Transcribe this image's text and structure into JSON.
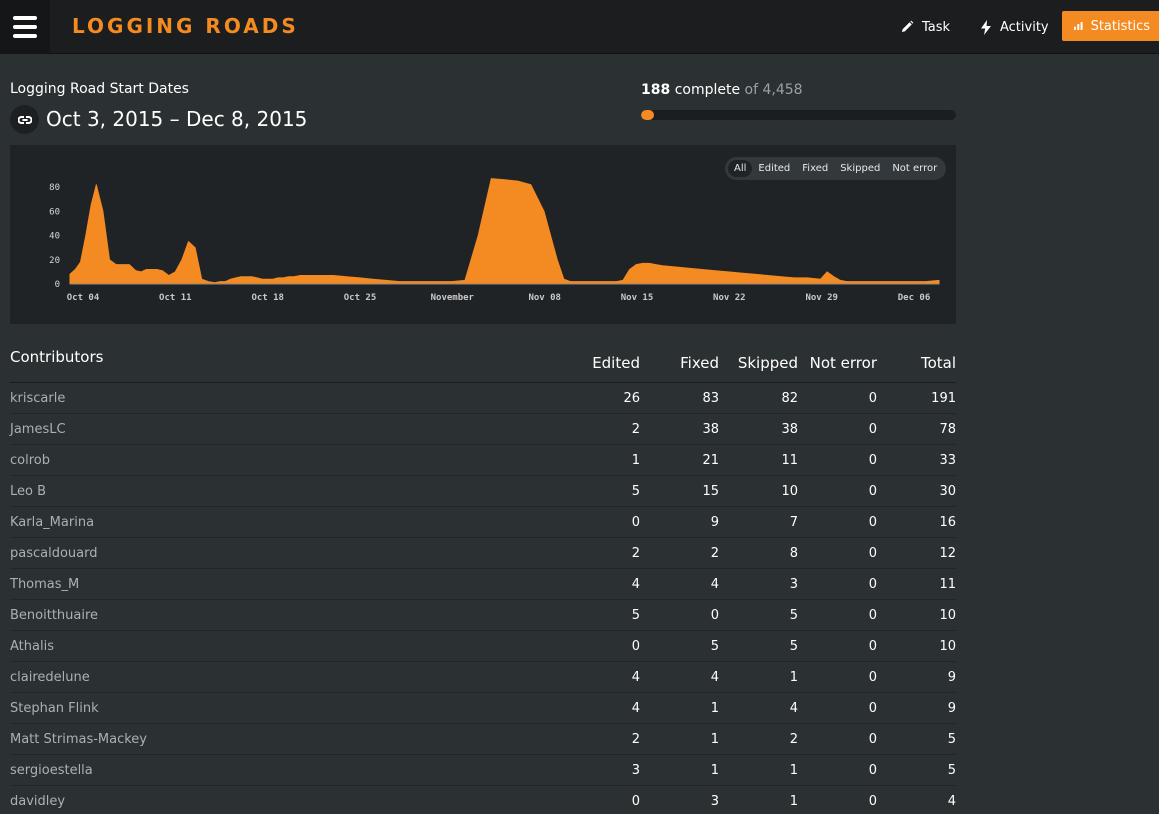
{
  "header": {
    "logo": "LOGGING ROADS",
    "nav": [
      {
        "label": "Task",
        "icon": "pencil-icon"
      },
      {
        "label": "Activity",
        "icon": "bolt-icon"
      },
      {
        "label": "Statistics",
        "icon": "bar-chart-icon",
        "active": true
      }
    ]
  },
  "title": {
    "label": "Logging Road Start Dates",
    "date_range": "Oct 3, 2015 – Dec 8, 2015",
    "icon": "link-icon"
  },
  "progress": {
    "complete": "188",
    "complete_label": "complete",
    "of_label": "of 4,458",
    "fraction": 0.042
  },
  "filters": [
    "All",
    "Edited",
    "Fixed",
    "Skipped",
    "Not error"
  ],
  "chart_data": {
    "type": "area",
    "color": "#f48a22",
    "x_tick_labels": [
      "Oct 04",
      "Oct 11",
      "Oct 18",
      "Oct 25",
      "November",
      "Nov 08",
      "Nov 15",
      "Nov 22",
      "Nov 29",
      "Dec 06"
    ],
    "y_tick_labels": [
      "0",
      "20",
      "40",
      "60",
      "80"
    ],
    "ylim": [
      0,
      90
    ],
    "x": [
      0,
      0.4,
      0.8,
      1.2,
      1.6,
      2.0,
      2.5,
      3.0,
      3.5,
      4.0,
      4.5,
      5.0,
      5.4,
      5.8,
      6.2,
      6.6,
      7.0,
      7.5,
      8.0,
      8.5,
      9.0,
      9.5,
      10.0,
      10.5,
      11.0,
      11.4,
      11.8,
      12.2,
      12.6,
      13.0,
      13.4,
      13.8,
      14.2,
      14.6,
      15.0,
      15.4,
      15.8,
      16.2,
      16.6,
      17.0,
      17.5,
      18.0,
      18.5,
      19.0,
      19.5,
      20.0,
      21.0,
      22.0,
      23.0,
      24.0,
      25.0,
      26.0,
      27.0,
      28.0,
      29.0,
      30.0,
      31.0,
      32.0,
      33.0,
      34.0,
      35.0,
      36.0,
      36.5,
      37.0,
      37.5,
      38.0,
      38.5,
      39.0,
      39.5,
      40.0,
      40.5,
      41.0,
      41.5,
      42.0,
      42.5,
      43.0,
      43.5,
      44.0,
      44.5,
      45.0,
      46.0,
      47.0,
      48.0,
      49.0,
      50.0,
      51.0,
      52.0,
      53.0,
      54.0,
      55.0,
      56.0,
      57.0,
      57.5,
      58.0,
      58.5,
      59.0,
      60.0,
      61.0,
      62.0,
      63.0,
      64.0,
      65.0,
      66.0
    ],
    "values": [
      8,
      12,
      18,
      40,
      65,
      82,
      60,
      20,
      16,
      16,
      16,
      11,
      10,
      12,
      12,
      12,
      11,
      7,
      10,
      20,
      35,
      30,
      4,
      2,
      1,
      2,
      2,
      4,
      5,
      6,
      6,
      6,
      5,
      4,
      4,
      4,
      5,
      5,
      6,
      6,
      7,
      7,
      7,
      7,
      7,
      7,
      6,
      5,
      4,
      3,
      2,
      2,
      2,
      2,
      2,
      3,
      40,
      87,
      86,
      85,
      82,
      60,
      40,
      20,
      4,
      2,
      2,
      2,
      2,
      2,
      2,
      2,
      2,
      3,
      12,
      16,
      17,
      17,
      16,
      15,
      14,
      13,
      12,
      11,
      10,
      9,
      8,
      7,
      6,
      5,
      5,
      4,
      10,
      6,
      3,
      2,
      2,
      2,
      2,
      2,
      2,
      2,
      3
    ]
  },
  "table": {
    "title": "Contributors",
    "columns": [
      "Edited",
      "Fixed",
      "Skipped",
      "Not error",
      "Total"
    ],
    "rows": [
      {
        "name": "kriscarle",
        "cells": [
          "26",
          "83",
          "82",
          "0",
          "191"
        ]
      },
      {
        "name": "JamesLC",
        "cells": [
          "2",
          "38",
          "38",
          "0",
          "78"
        ]
      },
      {
        "name": "colrob",
        "cells": [
          "1",
          "21",
          "11",
          "0",
          "33"
        ]
      },
      {
        "name": "Leo B",
        "cells": [
          "5",
          "15",
          "10",
          "0",
          "30"
        ]
      },
      {
        "name": "Karla_Marina",
        "cells": [
          "0",
          "9",
          "7",
          "0",
          "16"
        ]
      },
      {
        "name": "pascaldouard",
        "cells": [
          "2",
          "2",
          "8",
          "0",
          "12"
        ]
      },
      {
        "name": "Thomas_M",
        "cells": [
          "4",
          "4",
          "3",
          "0",
          "11"
        ]
      },
      {
        "name": "Benoitthuaire",
        "cells": [
          "5",
          "0",
          "5",
          "0",
          "10"
        ]
      },
      {
        "name": "Athalis",
        "cells": [
          "0",
          "5",
          "5",
          "0",
          "10"
        ]
      },
      {
        "name": "clairedelune",
        "cells": [
          "4",
          "4",
          "1",
          "0",
          "9"
        ]
      },
      {
        "name": "Stephan Flink",
        "cells": [
          "4",
          "1",
          "4",
          "0",
          "9"
        ]
      },
      {
        "name": "Matt Strimas-Mackey",
        "cells": [
          "2",
          "1",
          "2",
          "0",
          "5"
        ]
      },
      {
        "name": "sergioestella",
        "cells": [
          "3",
          "1",
          "1",
          "0",
          "5"
        ]
      },
      {
        "name": "davidley",
        "cells": [
          "0",
          "3",
          "1",
          "0",
          "4"
        ]
      }
    ]
  }
}
